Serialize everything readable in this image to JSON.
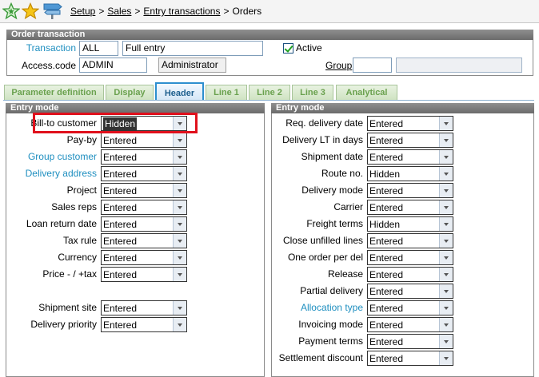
{
  "breadcrumb": {
    "items": [
      "Setup",
      "Sales",
      "Entry transactions"
    ],
    "current": "Orders",
    "separator": ">"
  },
  "toolbar": {
    "icons": [
      "favorites-star-outline-icon",
      "favorites-star-icon",
      "signpost-icon"
    ]
  },
  "order_transaction": {
    "title": "Order transaction",
    "transaction_label": "Transaction",
    "transaction_code": "ALL",
    "transaction_desc": "Full entry",
    "active_label": "Active",
    "active_checked": true,
    "access_label": "Access.code",
    "access_code": "ADMIN",
    "access_desc": "Administrator",
    "group_label": "Group",
    "group_code": "",
    "group_desc": ""
  },
  "tabs": [
    {
      "label": "Parameter definition",
      "active": false
    },
    {
      "label": "Display",
      "active": false
    },
    {
      "label": "Header",
      "active": true
    },
    {
      "label": "Line 1",
      "active": false
    },
    {
      "label": "Line 2",
      "active": false
    },
    {
      "label": "Line 3",
      "active": false
    },
    {
      "label": "Analytical",
      "active": false
    }
  ],
  "left_panel": {
    "title": "Entry mode",
    "fields": [
      {
        "label": "Bill-to customer",
        "value": "Hidden",
        "link": false
      },
      {
        "label": "Pay-by",
        "value": "Entered",
        "link": false
      },
      {
        "label": "Group customer",
        "value": "Entered",
        "link": true
      },
      {
        "label": "Delivery address",
        "value": "Entered",
        "link": true
      },
      {
        "label": "Project",
        "value": "Entered",
        "link": false
      },
      {
        "label": "Sales reps",
        "value": "Entered",
        "link": false
      },
      {
        "label": "Loan return date",
        "value": "Entered",
        "link": false
      },
      {
        "label": "Tax rule",
        "value": "Entered",
        "link": false
      },
      {
        "label": "Currency",
        "value": "Entered",
        "link": false
      },
      {
        "label": "Price - / +tax",
        "value": "Entered",
        "link": false
      },
      {
        "label": "Shipment site",
        "value": "Entered",
        "link": false
      },
      {
        "label": "Delivery priority",
        "value": "Entered",
        "link": false
      }
    ]
  },
  "right_panel": {
    "title": "Entry mode",
    "fields": [
      {
        "label": "Req. delivery date",
        "value": "Entered",
        "link": false
      },
      {
        "label": "Delivery LT in days",
        "value": "Entered",
        "link": false
      },
      {
        "label": "Shipment date",
        "value": "Entered",
        "link": false
      },
      {
        "label": "Route no.",
        "value": "Hidden",
        "link": false
      },
      {
        "label": "Delivery mode",
        "value": "Entered",
        "link": false
      },
      {
        "label": "Carrier",
        "value": "Entered",
        "link": false
      },
      {
        "label": "Freight terms",
        "value": "Hidden",
        "link": false
      },
      {
        "label": "Close unfilled lines",
        "value": "Entered",
        "link": false
      },
      {
        "label": "One order per del",
        "value": "Entered",
        "link": false
      },
      {
        "label": "Release",
        "value": "Entered",
        "link": false
      },
      {
        "label": "Partial delivery",
        "value": "Entered",
        "link": false
      },
      {
        "label": "Allocation type",
        "value": "Entered",
        "link": true
      },
      {
        "label": "Invoicing mode",
        "value": "Entered",
        "link": false
      },
      {
        "label": "Payment terms",
        "value": "Entered",
        "link": false
      },
      {
        "label": "Settlement discount",
        "value": "Entered",
        "link": false
      }
    ]
  },
  "colors": {
    "link_blue": "#1f8fc0",
    "highlight_red": "#e0101c",
    "panel_header_grey": "#7a7a7a",
    "tab_green": "#6aa14e",
    "tab_active_blue": "#2d8fcf"
  }
}
